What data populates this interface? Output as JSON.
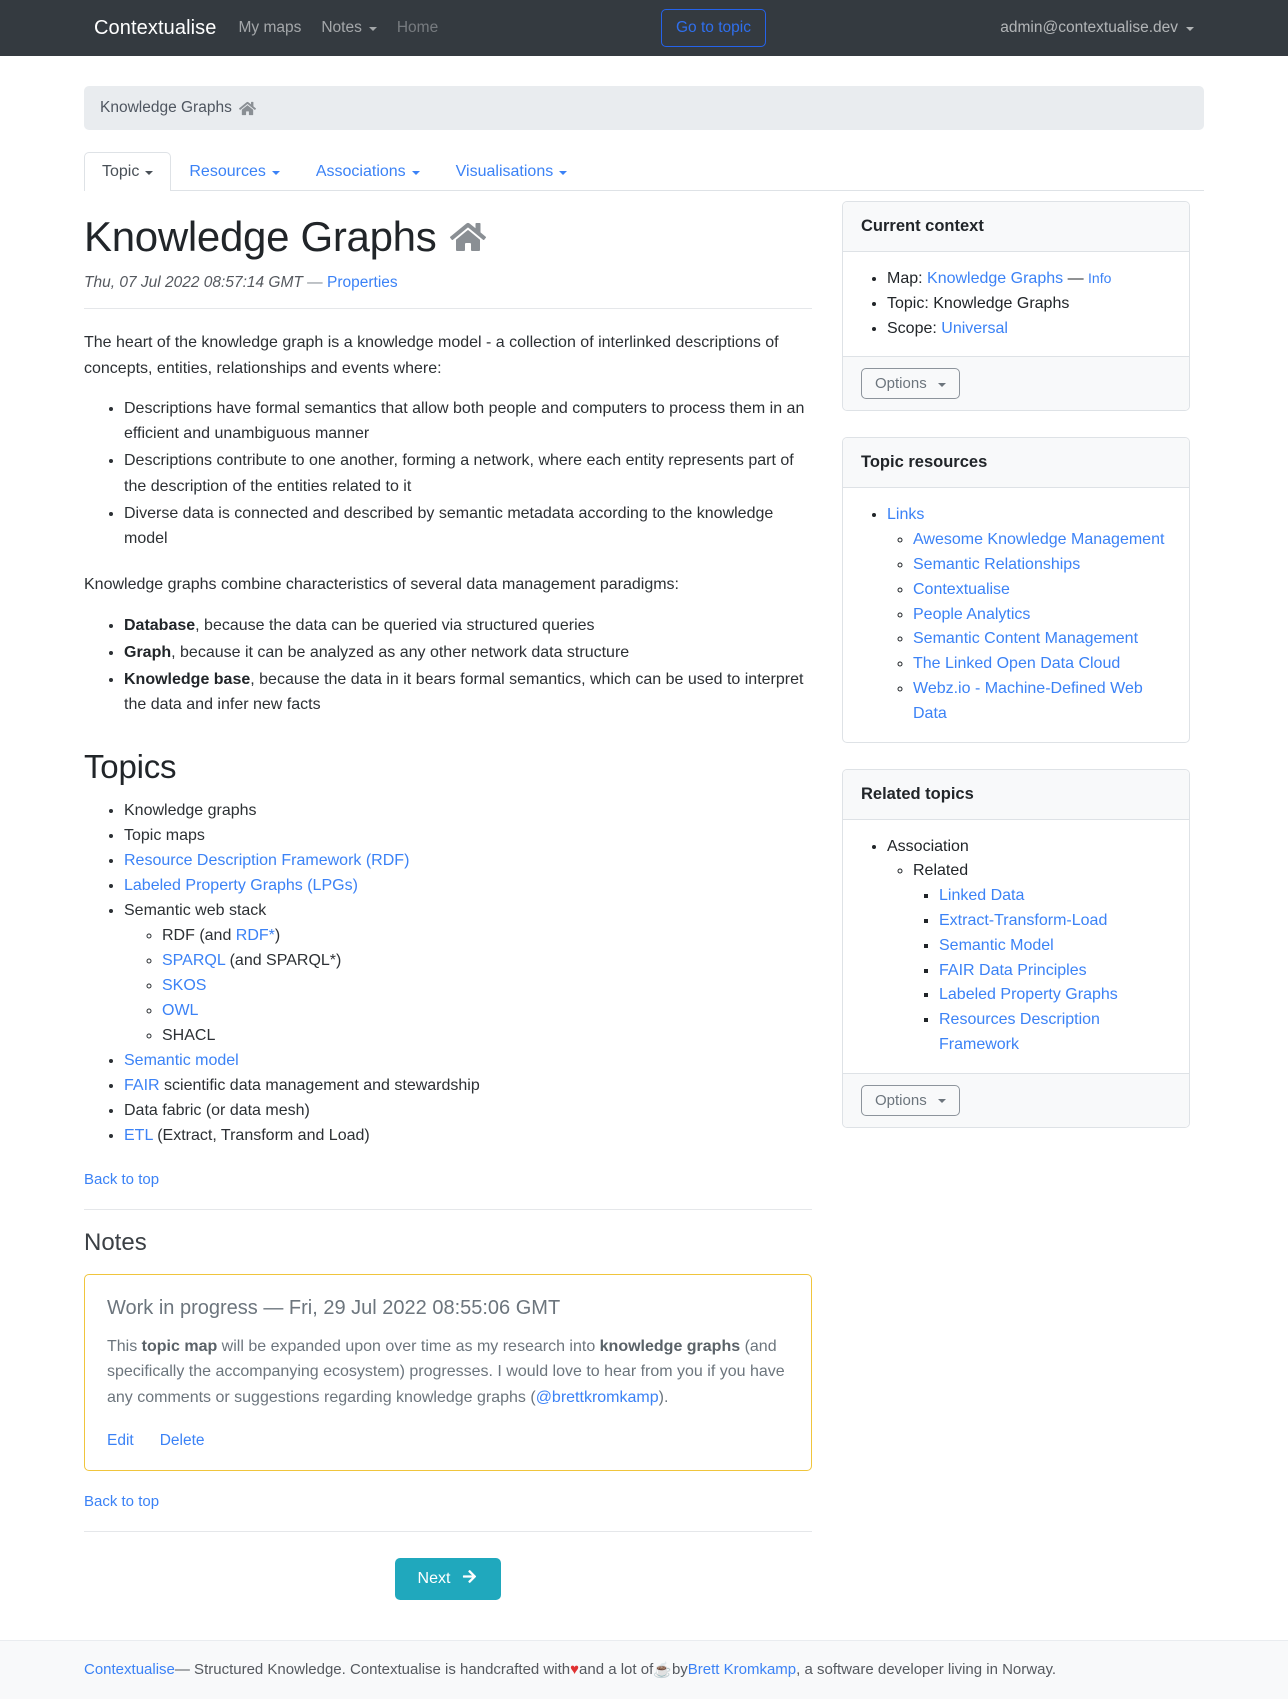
{
  "navbar": {
    "brand": "Contextualise",
    "links": [
      {
        "label": "My maps",
        "has_caret": false,
        "muted": false
      },
      {
        "label": "Notes",
        "has_caret": true,
        "muted": false
      },
      {
        "label": "Home",
        "has_caret": false,
        "muted": true
      }
    ],
    "goto_button": "Go to topic",
    "user": "admin@contextualise.dev"
  },
  "breadcrumb": {
    "label": "Knowledge Graphs",
    "icon": "home-icon"
  },
  "tabs": [
    {
      "label": "Topic",
      "active": true
    },
    {
      "label": "Resources",
      "active": false
    },
    {
      "label": "Associations",
      "active": false
    },
    {
      "label": "Visualisations",
      "active": false
    }
  ],
  "topic": {
    "title": "Knowledge Graphs",
    "title_icon": "home-icon",
    "timestamp": "Thu, 07 Jul 2022 08:57:14 GMT",
    "dash": "—",
    "properties_link": "Properties",
    "intro": "The heart of the knowledge graph is a knowledge model - a collection of interlinked descriptions of concepts, entities, relationships and events where:",
    "intro_bullets": [
      "Descriptions have formal semantics that allow both people and computers to process them in an efficient and unambiguous manner",
      "Descriptions contribute to one another, forming a network, where each entity represents part of the description of the entities related to it",
      "Diverse data is connected and described by semantic metadata according to the knowledge model"
    ],
    "paradigms_intro": "Knowledge graphs combine characteristics of several data management paradigms:",
    "paradigms": [
      {
        "term": "Database",
        "rest": ", because the data can be queried via structured queries"
      },
      {
        "term": "Graph",
        "rest": ", because it can be analyzed as any other network data structure"
      },
      {
        "term": "Knowledge base",
        "rest": ", because the data in it bears formal semantics, which can be used to interpret the data and infer new facts"
      }
    ]
  },
  "topics_section": {
    "heading": "Topics",
    "items": [
      {
        "text": "Knowledge graphs",
        "link": false
      },
      {
        "text": "Topic maps",
        "link": false
      },
      {
        "text": "Resource Description Framework (RDF)",
        "link": true
      },
      {
        "text": "Labeled Property Graphs (LPGs)",
        "link": true
      },
      {
        "text": "Semantic web stack",
        "link": false,
        "children": [
          {
            "pre": "RDF (and ",
            "link_text": "RDF*",
            "post": ")"
          },
          {
            "pre": "",
            "link_text": "SPARQL",
            "post": " (and SPARQL*)"
          },
          {
            "pre": "",
            "link_text": "SKOS",
            "post": ""
          },
          {
            "pre": "",
            "link_text": "OWL",
            "post": ""
          },
          {
            "pre": "SHACL",
            "link_text": "",
            "post": ""
          }
        ]
      },
      {
        "text": "Semantic model",
        "link": true
      },
      {
        "pre": "",
        "link_text": "FAIR",
        "post": " scientific data management and stewardship",
        "link": "partial"
      },
      {
        "text": "Data fabric (or data mesh)",
        "link": false
      },
      {
        "pre": "",
        "link_text": "ETL",
        "post": " (Extract, Transform and Load)",
        "link": "partial"
      }
    ],
    "back_to_top": "Back to top"
  },
  "notes_section": {
    "heading": "Notes",
    "note": {
      "title": "Work in progress",
      "dash": "—",
      "timestamp": "Fri, 29 Jul 2022 08:55:06 GMT",
      "body_part1": "This ",
      "body_bold1": "topic map",
      "body_part2": " will be expanded upon over time as my research into ",
      "body_bold2": "knowledge graphs",
      "body_part3": " (and specifically the accompanying ecosystem) progresses. I would love to hear from you if you have any comments or suggestions regarding knowledge graphs (",
      "body_link": "@brettkromkamp",
      "body_part4": ").",
      "edit": "Edit",
      "delete": "Delete"
    },
    "back_to_top": "Back to top"
  },
  "next_button": {
    "label": "Next",
    "icon": "arrow-right-icon",
    "color": "#20a8bd"
  },
  "sidebar": {
    "current_context": {
      "header": "Current context",
      "map_label": "Map:",
      "map_value": "Knowledge Graphs",
      "map_dash": "—",
      "map_info": "Info",
      "topic_label": "Topic:",
      "topic_value": "Knowledge Graphs",
      "scope_label": "Scope:",
      "scope_value": "Universal",
      "options": "Options"
    },
    "topic_resources": {
      "header": "Topic resources",
      "group": "Links",
      "items": [
        "Awesome Knowledge Management",
        "Semantic Relationships",
        "Contextualise",
        "People Analytics",
        "Semantic Content Management",
        "The Linked Open Data Cloud",
        "Webz.io - Machine-Defined Web Data"
      ]
    },
    "related_topics": {
      "header": "Related topics",
      "group": "Association",
      "subgroup": "Related",
      "items": [
        "Linked Data",
        "Extract-Transform-Load",
        "Semantic Model",
        "FAIR Data Principles",
        "Labeled Property Graphs",
        "Resources Description Framework"
      ],
      "options": "Options"
    }
  },
  "footer": {
    "brand_link": "Contextualise",
    "text1": " — Structured Knowledge. Contextualise is handcrafted with ",
    "heart": "♥",
    "text2": " and a lot of ",
    "coffee": "☕",
    "text3": " by ",
    "author_link": "Brett Kromkamp",
    "text4": ", a software developer living in Norway."
  },
  "colors": {
    "navbar_bg": "#343a40",
    "link": "#3b82f6",
    "accent_teal": "#20a8bd",
    "note_border": "#f0c53d",
    "breadcrumb_bg": "#e9ecef"
  }
}
